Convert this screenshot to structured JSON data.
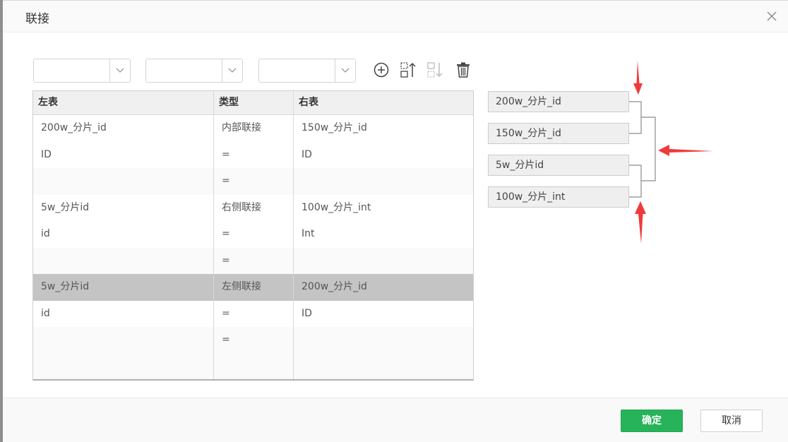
{
  "dialog": {
    "title": "联接",
    "close_icon": "close-icon"
  },
  "toolbar": {
    "selects": [
      {
        "value": ""
      },
      {
        "value": ""
      },
      {
        "value": ""
      }
    ],
    "icons": [
      "add-circle-icon",
      "move-up-icon",
      "move-down-icon",
      "delete-icon"
    ]
  },
  "table": {
    "headers": {
      "left": "左表",
      "type": "类型",
      "right": "右表"
    },
    "rows": [
      {
        "left": "200w_分片_id",
        "type": "内部联接",
        "right": "150w_分片_id"
      },
      {
        "left": "ID",
        "type": "=",
        "right": "ID"
      },
      {
        "left": "",
        "type": "=",
        "right": ""
      },
      {
        "left": "5w_分片id",
        "type": "右侧联接",
        "right": "100w_分片_int"
      },
      {
        "left": "id",
        "type": "=",
        "right": "Int"
      },
      {
        "left": "",
        "type": "=",
        "right": ""
      },
      {
        "left": "5w_分片id",
        "type": "左侧联接",
        "right": "200w_分片_id"
      },
      {
        "left": "id",
        "type": "=",
        "right": "ID"
      },
      {
        "left": "",
        "type": "=",
        "right": ""
      },
      {
        "left": "",
        "type": "",
        "right": ""
      }
    ],
    "selected_row": 6
  },
  "diagram": {
    "nodes": [
      "200w_分片_id",
      "150w_分片_id",
      "5w_分片id",
      "100w_分片_int"
    ],
    "annotation_color": "#f03a3a",
    "line_color": "#8a8a8a"
  },
  "footer": {
    "ok_label": "确定",
    "cancel_label": "取消",
    "ok_color": "#27b35a"
  }
}
